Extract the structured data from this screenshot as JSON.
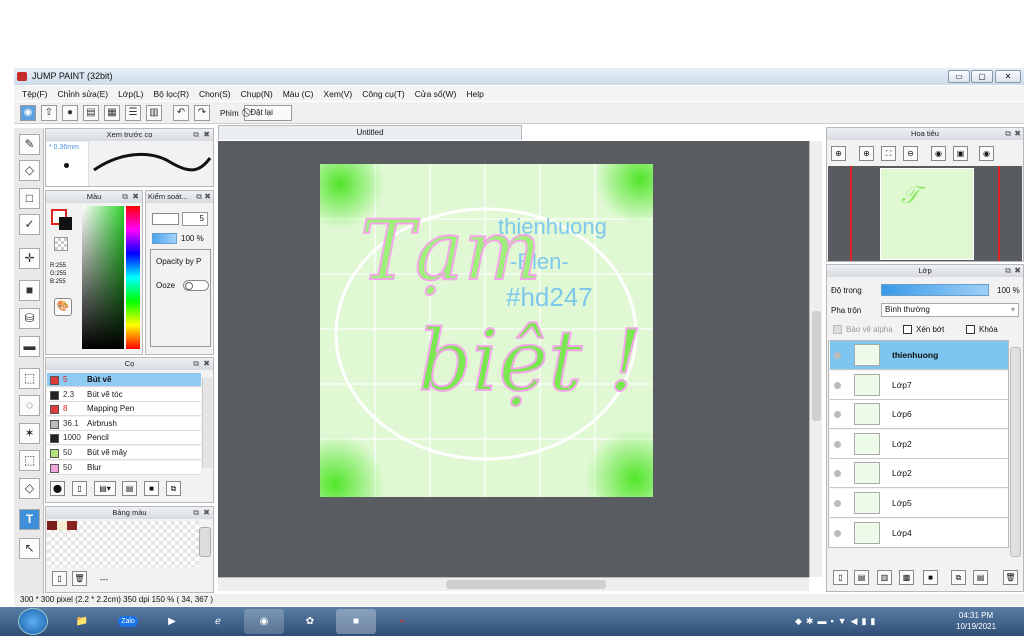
{
  "app": {
    "title": "JUMP PAINT (32bit)"
  },
  "menu": [
    "Tệp(F)",
    "Chỉnh sửa(E)",
    "Lớp(L)",
    "Bộ lọc(R)",
    "Chọn(S)",
    "Chụp(N)",
    "Màu (C)",
    "Xem(V)",
    "Công cụ(T)",
    "Cửa sổ(W)",
    "Help"
  ],
  "toolbar": {
    "phim": "Phím",
    "reset": "Đặt lại"
  },
  "preview": {
    "title": "Xem trước cọ",
    "size": "0.36mm"
  },
  "color": {
    "title": "Màu",
    "rgb_r": "R:255",
    "rgb_g": "G:255",
    "rgb_b": "B:255"
  },
  "control": {
    "title": "Kiểm soát...",
    "size": "5",
    "opacity": "100 %",
    "opacity_by": "Opacity by P",
    "ooze": "Ooze"
  },
  "brushes": {
    "title": "Cọ",
    "items": [
      {
        "size": "5",
        "name": "Bút vẽ",
        "color": "#e23b3b",
        "selected": true
      },
      {
        "size": "2.3",
        "name": "Bút vẽ tóc",
        "color": "#222222",
        "selected": false
      },
      {
        "size": "8",
        "name": "Mapping Pen",
        "color": "#e23b3b",
        "selected": false
      },
      {
        "size": "36.1",
        "name": "Airbrush",
        "color": "#bbbbbb",
        "selected": false
      },
      {
        "size": "1000",
        "name": "Pencil",
        "color": "#222222",
        "selected": false
      },
      {
        "size": "50",
        "name": "Bút vẽ mây",
        "color": "#b4e27a",
        "selected": false
      },
      {
        "size": "50",
        "name": "Blur",
        "color": "#f0a6da",
        "selected": false
      }
    ]
  },
  "palette": {
    "title": "Bảng màu",
    "dash": "---"
  },
  "document": {
    "tab": "Untitled",
    "texts": {
      "line1": "thienhuong",
      "line2": "-Blen-",
      "line3": "#hd247",
      "big1": "Tạm",
      "big2": "biệt !"
    }
  },
  "navigator": {
    "title": "Hoa tiêu"
  },
  "layers": {
    "title": "Lớp",
    "opacity_label": "Độ trong",
    "opacity": "100 %",
    "blend_label": "Pha trộn",
    "blend": "Bình thường",
    "protect_alpha": "Bảo vệ alpha",
    "clip": "Xén bớt",
    "lock": "Khóa",
    "items": [
      "thienhuong",
      "Lớp7",
      "Lớp6",
      "Lớp2",
      "Lớp2",
      "Lớp5",
      "Lớp4"
    ]
  },
  "status": {
    "text": "300 * 300 pixel  (2.2 * 2.2cm)  350 dpi  150 %  ( 34, 367 )"
  },
  "taskbar": {
    "time": "04:31 PM",
    "date": "10/19/2021",
    "zalo": "Zalo"
  }
}
